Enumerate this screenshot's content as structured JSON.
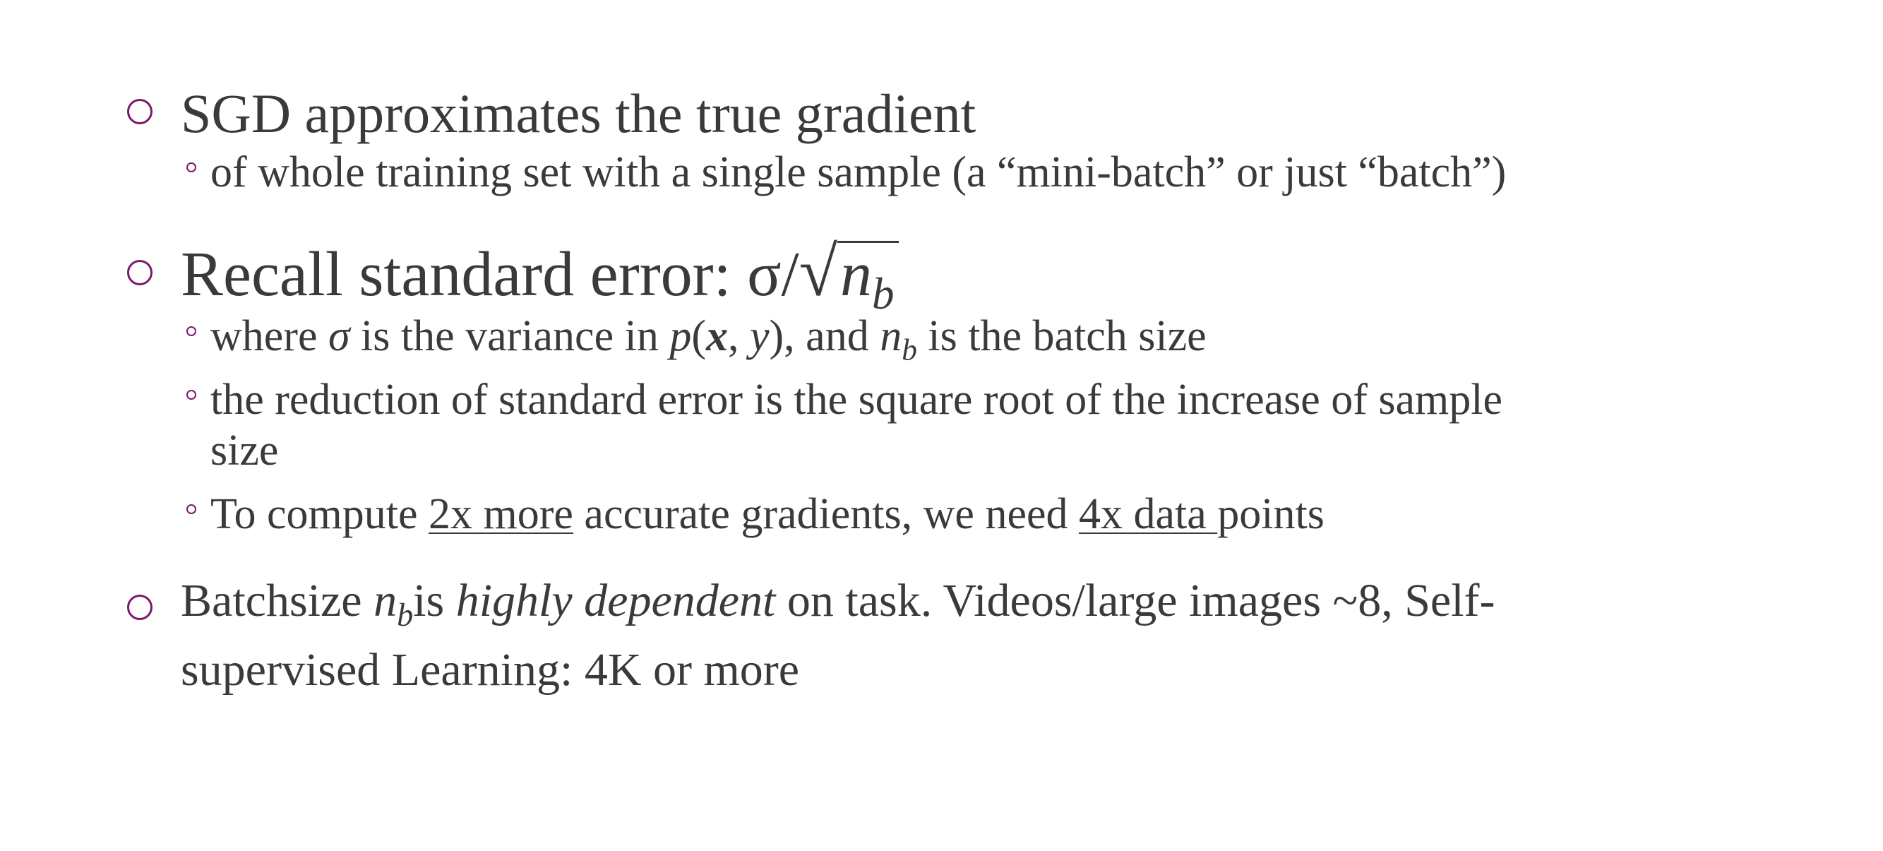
{
  "bullets": [
    {
      "text": "SGD approximates the true gradient",
      "subs": [
        {
          "text": "of whole training set with a single sample (a “mini-batch” or just “batch”)"
        }
      ]
    },
    {
      "prefix": "Recall standard error: ",
      "math_sigma": "σ/",
      "math_sqrt_sign": "√",
      "math_n": "n",
      "math_b": "b",
      "subs": [
        {
          "t1": "where ",
          "sigma": "σ",
          "t2": " is the variance in ",
          "p": "p",
          "paren_open": "(",
          "x": "x",
          "comma": ", ",
          "y": "y",
          "paren_close": ")",
          "t3": ", and ",
          "n": "n",
          "b": "b",
          "t4": " is the batch size"
        },
        {
          "line1": "the reduction of standard error is the square root of the increase of sample",
          "line2": "size"
        },
        {
          "t1": "To compute ",
          "u1": "2x more",
          "t2": " accurate gradients, we need ",
          "u2": "4x data ",
          "t3": "points"
        }
      ]
    },
    {
      "t1": "Batchsize ",
      "n": "n",
      "b": "b",
      "t2": "is ",
      "italic": "highly dependent",
      "t3": " on task. Videos/large images ~8, Self-",
      "line2": "supervised Learning: 4K or more"
    }
  ],
  "colors": {
    "bullet_marker": "#7a1a6a",
    "text": "#3a3a3a"
  }
}
